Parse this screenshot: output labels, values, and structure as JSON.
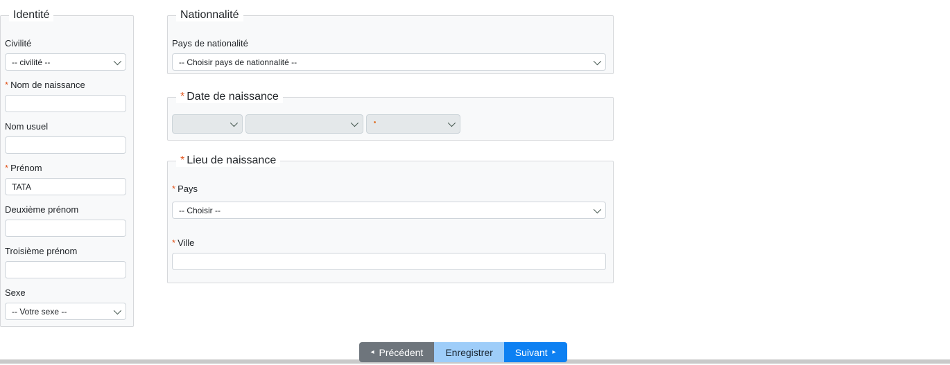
{
  "required_marker": "*",
  "colors": {
    "required_asterisk": "#e2571f",
    "fieldset_background": "#f8f9fa",
    "button_prev_bg": "#6e757c",
    "button_save_bg": "#9ecdf9",
    "button_next_bg": "#0d80f2",
    "bottom_bar": "#c9c9c9"
  },
  "identity": {
    "legend": "Identité",
    "fields": [
      {
        "label": "Civilité",
        "required": false,
        "type": "select",
        "value": "-- civilité --"
      },
      {
        "label": "Nom de naissance",
        "required": true,
        "type": "text",
        "value": ""
      },
      {
        "label": "Nom usuel",
        "required": false,
        "type": "text",
        "value": ""
      },
      {
        "label": "Prénom",
        "required": true,
        "type": "text",
        "value": "TATA"
      },
      {
        "label": "Deuxième prénom",
        "required": false,
        "type": "text",
        "value": ""
      },
      {
        "label": "Troisième prénom",
        "required": false,
        "type": "text",
        "value": ""
      },
      {
        "label": "Sexe",
        "required": false,
        "type": "select",
        "value": "-- Votre sexe --"
      }
    ]
  },
  "nationality": {
    "legend": "Nationnalité",
    "fields": [
      {
        "label": "Pays de nationalité",
        "required": false,
        "type": "select",
        "value": "-- Choisir pays de nationnalité --"
      }
    ]
  },
  "birth_date": {
    "legend": "Date de naissance",
    "required": true,
    "selects": [
      {
        "name": "day",
        "value": ""
      },
      {
        "name": "month",
        "value": ""
      },
      {
        "name": "year",
        "value": ""
      }
    ]
  },
  "birth_place": {
    "legend": "Lieu de naissance",
    "required": true,
    "fields": [
      {
        "label": "Pays",
        "required": true,
        "type": "select",
        "value": "-- Choisir --"
      },
      {
        "label": "Ville",
        "required": true,
        "type": "text",
        "value": ""
      }
    ]
  },
  "footer": {
    "prev_label": "Précédent",
    "save_label": "Enregistrer",
    "next_label": "Suivant",
    "prev_arrow": "◂",
    "next_arrow": "▸"
  }
}
